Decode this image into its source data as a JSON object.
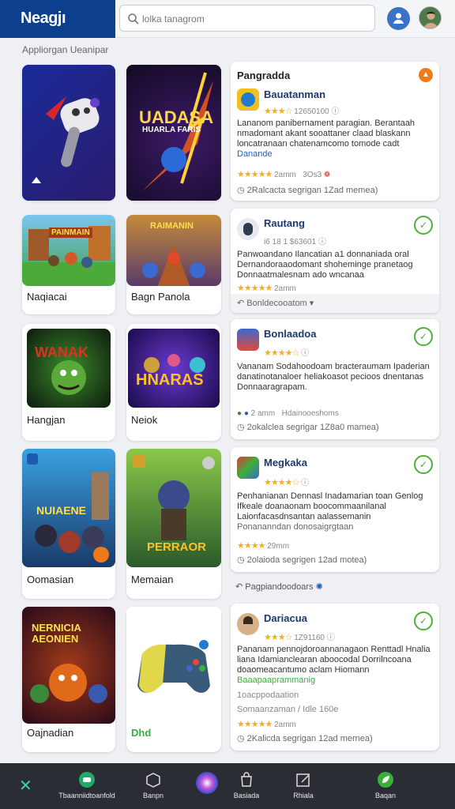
{
  "header": {
    "brand": "Neagjı",
    "search_placeholder": "lolka tanagrom",
    "action_icon": "person-share-icon",
    "avatar_icon": "user-avatar"
  },
  "breadcrumb": "Appliorgan Ueanipar",
  "tiles": [
    {
      "label": ""
    },
    {
      "label": ""
    },
    {
      "label": "Naqiacai"
    },
    {
      "label": "Bagn Panola"
    },
    {
      "label": "Hangjan"
    },
    {
      "label": "Neiok"
    },
    {
      "label": "Oomasian"
    },
    {
      "label": "Memaian"
    },
    {
      "label": "Oajnadian"
    },
    {
      "label": "Dhd"
    }
  ],
  "tile_art_text": {
    "t2": "UADASA",
    "t2b": "HUARLA FARIS",
    "t3": "PAINMAIN",
    "t4": "RAIMANIN",
    "t5": "WANAK",
    "t6": "HNARAS",
    "t7": "NUIAENE",
    "t8": "PERRAOR",
    "t9": "NERNICIA AEONIEN"
  },
  "cards": [
    {
      "section": "Pangradda",
      "title": "Bauatanman",
      "meta": "12650100",
      "desc": "Lananom panibernament paragian. Berantaah nmadomant akant sooattaner claad blaskann loncatranaan chatenamcomo tomode cadt",
      "desc_tail": "Danande",
      "rating_text": "2amm",
      "rating_num": "3Os3",
      "foot": "2Ralcacta segrigan 1Zad memea)"
    },
    {
      "title": "Rautang",
      "meta": "i6 18 1 $63601",
      "desc": "Panwoandano Ilancatian a1 donnaniada oral Dernandoraaodomant shoheminge pranetaog Donnaatmalesnam ado wncanaa",
      "rating_text": "2amm",
      "foot": "Bonldecooatom"
    },
    {
      "title": "Bonlaadoa",
      "meta": "",
      "desc": "Vananam Sodahoodoam bracteraumam Ipaderian danatinotanaloer heliakoasot pecioos dnentanas Donnaaragrapam.",
      "rating_text": "2 amm",
      "rating_tail": "Hdainooeshoms",
      "foot": "2okalclea segrigar 1Z8a0 mamea)"
    },
    {
      "title": "Megkaka",
      "meta": "",
      "desc": "Penhanianan Dennasl Inadamarian toan Genlog Ifkeale doanaonam boocommaanilanal Laionfacasdnsantan aalassemanin",
      "desc_tail": "Ponananndan donosaigrgtaan",
      "rating_text": "29mm",
      "foot": "2olaioda segrigen 12ad motea)"
    },
    {
      "title": "Dariacua",
      "meta": "1Z91160",
      "desc": "Pananam pennojdoroannanagaon Renttadl Hnalia liana Idamianclearan aboocodal Dorrilncoana doaomeacantumo aclam Hiomann",
      "desc_tail": "Baaapaaprammanig",
      "rating_text": "2amm",
      "foot1": "1oacppodaation",
      "foot2": "Somaanzaman / Idle 160e",
      "foot": "2Kalicda segrigan 12ad mernea)"
    }
  ],
  "related_label": "Pagpiandoodoars",
  "bottom_nav": [
    {
      "label": "Tbaanniidtoanfold",
      "icon": "game-controller-icon"
    },
    {
      "label": "Banpn",
      "icon": "box-icon"
    },
    {
      "label": "",
      "icon": "assistant-orb-icon"
    },
    {
      "label": "Basiada",
      "icon": "bag-icon"
    },
    {
      "label": "Rhiala",
      "icon": "edit-box-icon"
    },
    {
      "label": "Baqan",
      "icon": "leaf-icon"
    }
  ],
  "colors": {
    "brand_blue": "#0c3f8e",
    "accent_green": "#4fae3a",
    "star_yellow": "#f2b01e",
    "bottom_bar": "#2a2d33"
  }
}
